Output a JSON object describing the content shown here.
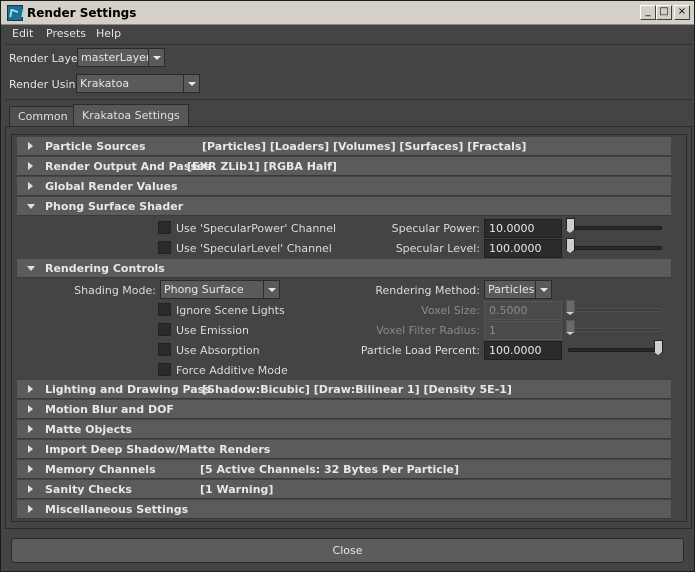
{
  "window": {
    "title": "Render Settings"
  },
  "menubar": [
    "Edit",
    "Presets",
    "Help"
  ],
  "render_layer": {
    "label": "Render Layer",
    "value": "masterLayer"
  },
  "render_using": {
    "label": "Render Using",
    "value": "Krakatoa"
  },
  "tabs": [
    {
      "label": "Common",
      "active": false
    },
    {
      "label": "Krakatoa Settings",
      "active": true
    }
  ],
  "frames_top": [
    {
      "title": "Particle Sources",
      "info": "[Particles] [Loaders] [Volumes] [Surfaces] [Fractals]"
    },
    {
      "title": "Render Output And Passes",
      "info": "[EXR ZLib1] [RGBA Half]"
    },
    {
      "title": "Global Render Values",
      "info": ""
    }
  ],
  "phong": {
    "title": "Phong Surface Shader",
    "specular_power_channel_label": "Use 'SpecularPower' Channel",
    "specular_level_channel_label": "Use 'SpecularLevel' Channel",
    "specular_power_label": "Specular Power:",
    "specular_power_value": "10.0000",
    "specular_power_slider": 0.0,
    "specular_level_label": "Specular Level:",
    "specular_level_value": "100.0000",
    "specular_level_slider": 0.0
  },
  "rendering_controls": {
    "title": "Rendering Controls",
    "shading_mode_label": "Shading Mode:",
    "shading_mode_value": "Phong Surface",
    "rendering_method_label": "Rendering Method:",
    "rendering_method_value": "Particles",
    "ignore_scene_lights_label": "Ignore Scene Lights",
    "use_emission_label": "Use Emission",
    "use_absorption_label": "Use Absorption",
    "force_additive_label": "Force Additive Mode",
    "voxel_size_label": "Voxel Size:",
    "voxel_size_value": "0.5000",
    "voxel_filter_radius_label": "Voxel Filter Radius:",
    "voxel_filter_radius_value": "1",
    "particle_load_percent_label": "Particle Load Percent:",
    "particle_load_percent_value": "100.0000",
    "particle_load_percent_slider": 1.0
  },
  "frames_bottom": [
    {
      "title": "Lighting and Drawing Pass",
      "info": "[Shadow:Bicubic] [Draw:Bilinear 1] [Density 5E-1]"
    },
    {
      "title": "Motion Blur and DOF",
      "info": ""
    },
    {
      "title": "Matte Objects",
      "info": ""
    },
    {
      "title": "Import Deep Shadow/Matte Renders",
      "info": ""
    },
    {
      "title": "Memory Channels",
      "info": "[5 Active Channels: 32 Bytes Per Particle]"
    },
    {
      "title": "Sanity Checks",
      "info": "[1 Warning]"
    },
    {
      "title": "Miscellaneous Settings",
      "info": ""
    }
  ],
  "close_label": "Close"
}
